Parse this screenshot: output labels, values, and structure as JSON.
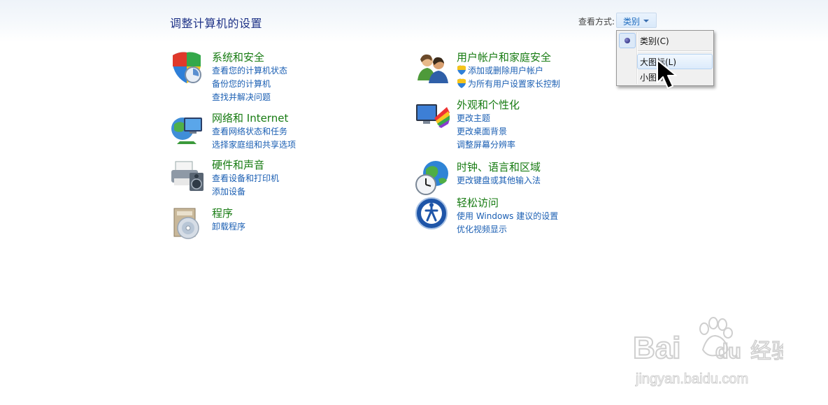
{
  "header": {
    "title": "调整计算机的设置",
    "view_by_label": "查看方式:",
    "view_by_value": "类别"
  },
  "categories": [
    {
      "title": "系统和安全",
      "icon": "shield-security-icon",
      "links": [
        "查看您的计算机状态",
        "备份您的计算机",
        "查找并解决问题"
      ]
    },
    {
      "title": "网络和 Internet",
      "icon": "network-globe-icon",
      "links": [
        "查看网络状态和任务",
        "选择家庭组和共享选项"
      ]
    },
    {
      "title": "硬件和声音",
      "icon": "printer-icon",
      "links": [
        "查看设备和打印机",
        "添加设备"
      ]
    },
    {
      "title": "程序",
      "icon": "programs-disc-icon",
      "links": [
        "卸载程序"
      ]
    },
    {
      "title": "用户帐户和家庭安全",
      "icon": "users-icon",
      "links": [
        "添加或删除用户帐户",
        "为所有用户设置家长控制"
      ]
    },
    {
      "title": "外观和个性化",
      "icon": "appearance-monitor-icon",
      "links": [
        "更改主题",
        "更改桌面背景",
        "调整屏幕分辨率"
      ]
    },
    {
      "title": "时钟、语言和区域",
      "icon": "clock-globe-icon",
      "links": [
        "更改键盘或其他输入法"
      ]
    },
    {
      "title": "轻松访问",
      "icon": "accessibility-icon",
      "links": [
        "使用 Windows 建议的设置",
        "优化视频显示"
      ]
    }
  ],
  "view_menu": {
    "items": [
      "类别(C)",
      "大图标(L)",
      "小图标"
    ],
    "selected": "类别(C)",
    "hovered": "大图标(L)"
  },
  "watermark": {
    "brand": "Baidu",
    "brand_cn": "经验",
    "url": "jingyan.baidu.com"
  },
  "colors": {
    "category_title": "#177b12",
    "link": "#1b5fb3",
    "page_title": "#1e3287"
  }
}
